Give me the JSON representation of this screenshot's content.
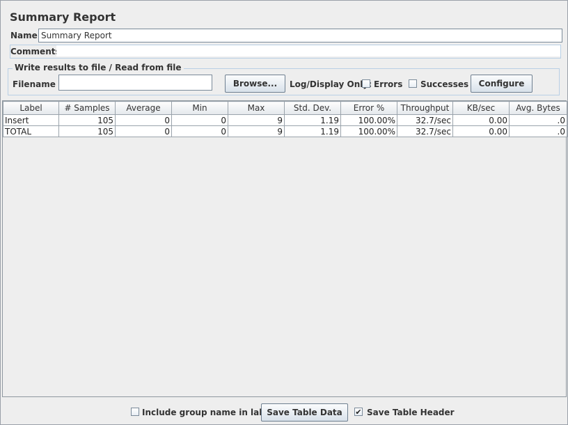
{
  "window": {
    "title": "Summary Report"
  },
  "name_field": {
    "label": "Name:",
    "value": "Summary Report"
  },
  "comments_field": {
    "label": "Comments:",
    "value": ""
  },
  "file_section": {
    "legend": "Write results to file / Read from file",
    "filename_label": "Filename",
    "filename_value": "",
    "browse_label": "Browse...",
    "log_display_label": "Log/Display Only:",
    "errors_label": "Errors",
    "errors_checked": false,
    "successes_label": "Successes",
    "successes_checked": false,
    "configure_label": "Configure"
  },
  "table": {
    "headers": [
      "Label",
      "# Samples",
      "Average",
      "Min",
      "Max",
      "Std. Dev.",
      "Error %",
      "Throughput",
      "KB/sec",
      "Avg. Bytes"
    ],
    "rows": [
      [
        "Insert",
        "105",
        "0",
        "0",
        "9",
        "1.19",
        "100.00%",
        "32.7/sec",
        "0.00",
        ".0"
      ],
      [
        "TOTAL",
        "105",
        "0",
        "0",
        "9",
        "1.19",
        "100.00%",
        "32.7/sec",
        "0.00",
        ".0"
      ]
    ]
  },
  "footer": {
    "include_group_label": "Include group name in label?",
    "include_group_checked": false,
    "save_table_data_label": "Save Table Data",
    "save_header_label": "Save Table Header",
    "save_header_checked": true,
    "check_glyph": "✔"
  }
}
